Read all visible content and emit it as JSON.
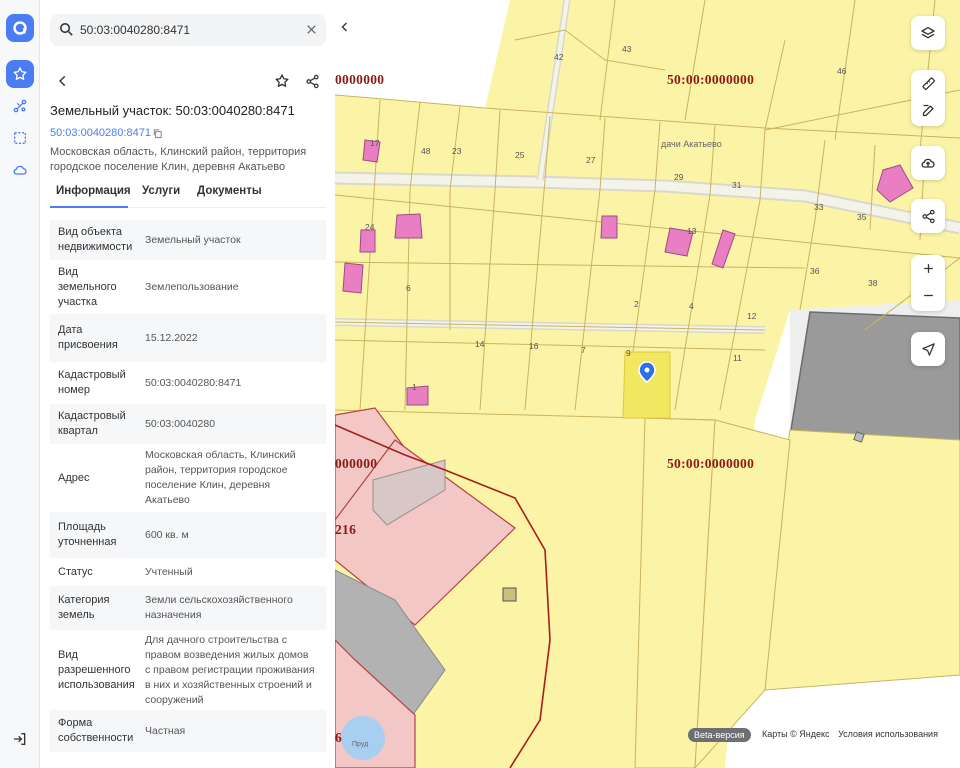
{
  "search": {
    "value": "50:03:0040280:8471"
  },
  "plot": {
    "title": "Земельный участок: 50:03:0040280:8471",
    "cadastral_link": "50:03:0040280:8471",
    "address_line1": "Московская область, Клинский район, территория",
    "address_line2": "городское поселение Клин, деревня Акатьево"
  },
  "tabs": [
    {
      "label": "Информация"
    },
    {
      "label": "Услуги"
    },
    {
      "label": "Документы"
    }
  ],
  "info_rows": [
    {
      "label_lines": [
        "Вид объекта",
        "недвижимости"
      ],
      "value_lines": [
        "Земельный участок"
      ]
    },
    {
      "label_lines": [
        "Вид",
        "земельного",
        "участка"
      ],
      "value_lines": [
        "Землепользование"
      ]
    },
    {
      "label_lines": [
        "Дата",
        "присвоения"
      ],
      "value_lines": [
        "15.12.2022"
      ]
    },
    {
      "label_lines": [
        "Кадастровый",
        "номер"
      ],
      "value_lines": [
        "50:03:0040280:8471"
      ]
    },
    {
      "label_lines": [
        "Кадастровый",
        "квартал"
      ],
      "value_lines": [
        "50:03:0040280"
      ]
    },
    {
      "label_lines": [
        "Адрес"
      ],
      "value_lines": [
        "Московская область, Клинский",
        "район, территория городское",
        "поселение Клин, деревня",
        "Акатьево"
      ]
    },
    {
      "label_lines": [
        "Площадь",
        "уточненная"
      ],
      "value_lines": [
        "600 кв. м"
      ]
    },
    {
      "label_lines": [
        "Статус"
      ],
      "value_lines": [
        "Учтенный"
      ]
    },
    {
      "label_lines": [
        "Категория",
        "земель"
      ],
      "value_lines": [
        "Земли сельскохозяйственного",
        "назначения"
      ]
    },
    {
      "label_lines": [
        "Вид",
        "разрешенного",
        "использования"
      ],
      "value_lines": [
        "Для дачного строительства с",
        "правом возведения жилых домов",
        "с правом регистрации проживания",
        "в них и хозяйственных строений и",
        "сооружений"
      ]
    },
    {
      "label_lines": [
        "Форма",
        "собственности"
      ],
      "value_lines": [
        "Частная"
      ]
    }
  ],
  "map": {
    "zone_labels": [
      "0000000",
      "50:00:0000000",
      "000000",
      "50:00:0000000",
      "216",
      "6"
    ],
    "place_label": "дачи Акатьево",
    "lake_label": "Пруд",
    "plot_numbers": [
      "42",
      "43",
      "46",
      "47",
      "48",
      "23",
      "25",
      "27",
      "29",
      "31",
      "33",
      "35",
      "36",
      "38",
      "6",
      "2",
      "4",
      "12",
      "14",
      "16",
      "7",
      "9",
      "11",
      "13",
      "17",
      "24",
      "1",
      "3"
    ],
    "beta_label": "Beta-версия",
    "attribution": [
      "Карты © Яндекс",
      "Условия использования"
    ]
  },
  "colors": {
    "accent": "#4a7cf3",
    "map_land": "#fbf4a6",
    "zone_border": "#a61e1e",
    "building": "#e97fc2",
    "selected_plot": "#f2e760"
  },
  "icons": {
    "logo": "avito-logo",
    "rail": [
      "star-icon",
      "route-icon",
      "select-area-icon",
      "cloud-icon",
      "exit-icon"
    ],
    "map_tools": [
      "layers-icon",
      "ruler-icon",
      "edit-icon",
      "upload-icon",
      "share-icon",
      "zoom-in-icon",
      "zoom-out-icon",
      "locate-icon"
    ]
  }
}
